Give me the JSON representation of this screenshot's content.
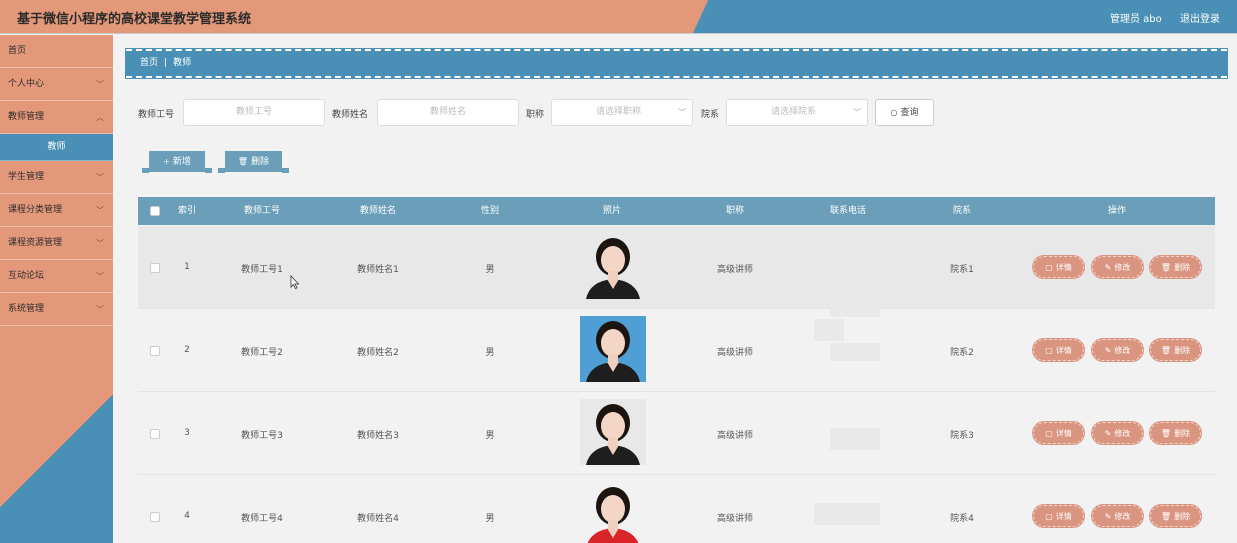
{
  "header": {
    "title": "基于微信小程序的高校课堂教学管理系统",
    "user": "管理员 abo",
    "logout": "退出登录"
  },
  "sidebar": {
    "items": [
      {
        "label": "首页",
        "has_children": false
      },
      {
        "label": "个人中心",
        "has_children": true
      },
      {
        "label": "教师管理",
        "has_children": true
      },
      {
        "label": "教师",
        "sub": true
      },
      {
        "label": "学生管理",
        "has_children": true
      },
      {
        "label": "课程分类管理",
        "has_children": true
      },
      {
        "label": "课程资源管理",
        "has_children": true
      },
      {
        "label": "互动论坛",
        "has_children": true
      },
      {
        "label": "系统管理",
        "has_children": true
      }
    ]
  },
  "breadcrumb": {
    "home": "首页",
    "current": "教师"
  },
  "search": {
    "teacher_no_label": "教师工号",
    "teacher_no_placeholder": "教师工号",
    "teacher_name_label": "教师姓名",
    "teacher_name_placeholder": "教师姓名",
    "title_label": "职称",
    "title_placeholder": "请选择职称",
    "dept_label": "院系",
    "dept_placeholder": "请选择院系",
    "query_label": "查询"
  },
  "actions": {
    "add": "新增",
    "delete": "删除"
  },
  "table": {
    "headers": [
      "索引",
      "教师工号",
      "教师姓名",
      "性别",
      "照片",
      "职称",
      "联系电话",
      "院系",
      "操作"
    ],
    "rows": [
      {
        "index": "1",
        "no": "教师工号1",
        "name": "教师姓名1",
        "gender": "男",
        "title": "高级讲师",
        "dept": "院系1",
        "photo_bg": "#e8e8e8",
        "outfit": "#1e1e1e"
      },
      {
        "index": "2",
        "no": "教师工号2",
        "name": "教师姓名2",
        "gender": "男",
        "title": "高级讲师",
        "dept": "院系2",
        "photo_bg": "#4f9fd6",
        "outfit": "#1e1e1e"
      },
      {
        "index": "3",
        "no": "教师工号3",
        "name": "教师姓名3",
        "gender": "男",
        "title": "高级讲师",
        "dept": "院系3",
        "photo_bg": "#e8e8e8",
        "outfit": "#1e1e1e"
      },
      {
        "index": "4",
        "no": "教师工号4",
        "name": "教师姓名4",
        "gender": "男",
        "title": "高级讲师",
        "dept": "院系4",
        "photo_bg": "#f2f2f2",
        "outfit": "#d9252a"
      }
    ],
    "op_labels": {
      "detail": "详情",
      "edit": "修改",
      "delete": "删除"
    }
  },
  "colors": {
    "accent_orange": "#e4987a",
    "accent_blue": "#4a8fb5",
    "table_head": "#6b9fb9",
    "op_button": "#d99580"
  }
}
